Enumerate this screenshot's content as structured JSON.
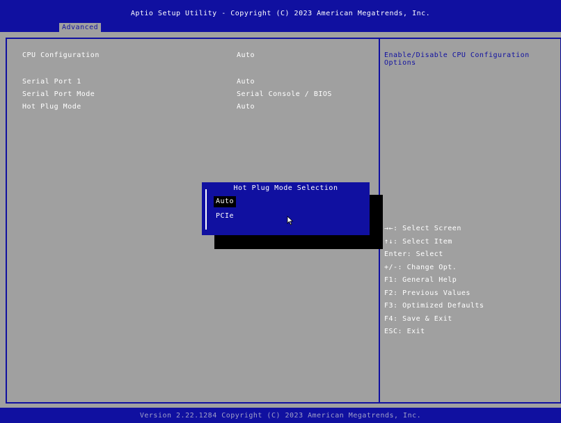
{
  "header": {
    "title": "Aptio Setup Utility - Copyright (C) 2023 American Megatrends, Inc.",
    "active_tab": "Advanced"
  },
  "settings": [
    {
      "label": "CPU Configuration",
      "value": "Auto"
    },
    {
      "label": "Serial Port 1",
      "value": "Auto"
    },
    {
      "label": "Serial Port Mode",
      "value": "Serial Console / BIOS"
    },
    {
      "label": "Hot Plug Mode",
      "value": "Auto"
    }
  ],
  "help": {
    "description": "Enable/Disable CPU Configuration Options",
    "keys": [
      "→←: Select Screen",
      "↑↓: Select Item",
      "Enter: Select",
      "+/-: Change Opt.",
      "F1: General Help",
      "F2: Previous Values",
      "F3: Optimized Defaults",
      "F4: Save & Exit",
      "ESC: Exit"
    ]
  },
  "popup": {
    "title": "Hot Plug Mode Selection",
    "options": [
      {
        "label": "Auto",
        "selected": true
      },
      {
        "label": "PCIe",
        "selected": false
      }
    ]
  },
  "footer": {
    "text": "Version 2.22.1284 Copyright (C) 2023 American Megatrends, Inc."
  }
}
